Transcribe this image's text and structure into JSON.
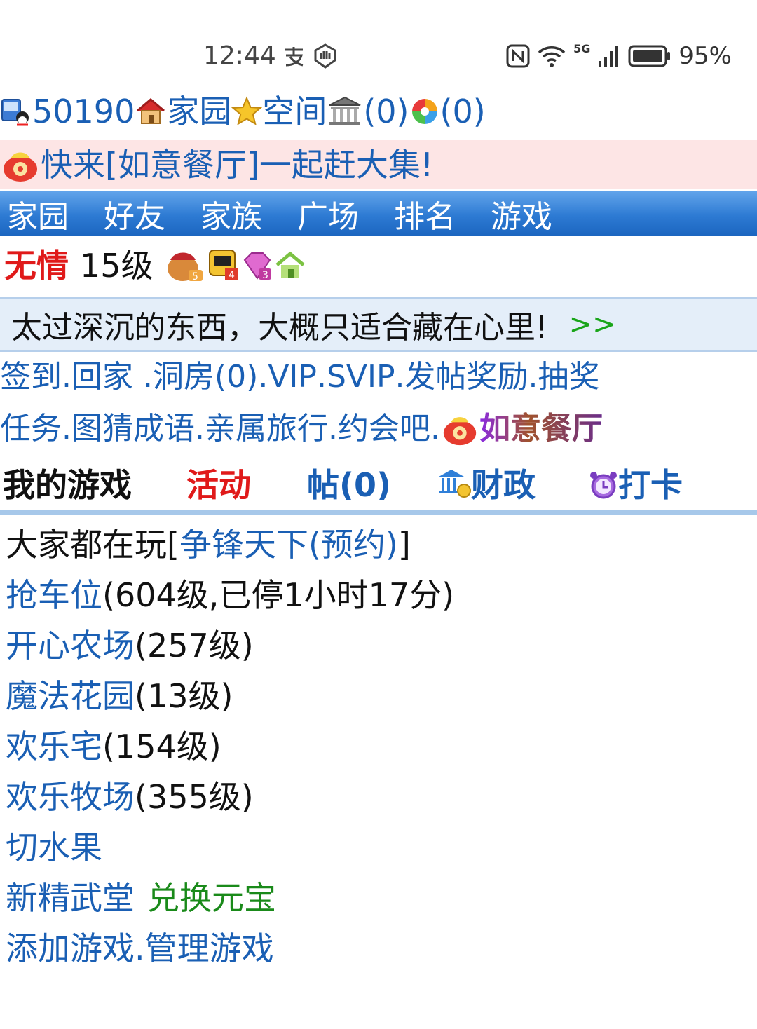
{
  "status_bar": {
    "time": "12:44",
    "network": "5G",
    "battery": "95%"
  },
  "header": {
    "user_id": "50190",
    "home": "家园",
    "space": "空间",
    "bank_count": "(0)",
    "photo_count": "(0)"
  },
  "banner": {
    "text": "快来[如意餐厅]一起赶大集!"
  },
  "nav": [
    "家园",
    "好友",
    "家族",
    "广场",
    "排名",
    "游戏"
  ],
  "profile": {
    "name": "无情",
    "level": "15级"
  },
  "quote": {
    "text": "太过深沉的东西，大概只适合藏在心里!",
    "more": ">>"
  },
  "links_row1": [
    "签到",
    "回家 ",
    "洞房(0)",
    "VIP",
    "SVIP",
    "发帖奖励",
    "抽奖"
  ],
  "links_row2": [
    "任务",
    "图猜成语",
    "亲属旅行",
    "约会吧",
    "如意餐厅"
  ],
  "tabs": {
    "my_games": "我的游戏",
    "activity": "活动",
    "posts": "帖(0)",
    "finance": "财政",
    "checkin": "打卡"
  },
  "games": {
    "playing_prefix": "大家都在玩[",
    "playing_link": "争锋天下(预约)",
    "playing_suffix": "]",
    "list": [
      {
        "name": "抢车位",
        "info": "(604级,已停1小时17分)"
      },
      {
        "name": "开心农场",
        "info": "(257级)"
      },
      {
        "name": "魔法花园",
        "info": "(13级)"
      },
      {
        "name": "欢乐宅",
        "info": "(154级)"
      },
      {
        "name": "欢乐牧场",
        "info": "(355级)"
      },
      {
        "name": "切水果",
        "info": ""
      }
    ],
    "new_game": "新精武堂",
    "exchange": "兑换元宝",
    "add_games": "添加游戏",
    "manage_games": "管理游戏"
  },
  "colors": {
    "link": "#1a5fb4",
    "red": "#e01a1a",
    "green": "#1a8a1a",
    "nav_bg": "#2d7ad3"
  }
}
